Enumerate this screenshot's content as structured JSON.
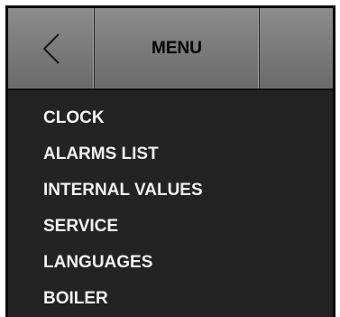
{
  "header": {
    "back_icon": "chevron-left-icon",
    "title": "MENU"
  },
  "menu": {
    "items": [
      {
        "label": "CLOCK"
      },
      {
        "label": "ALARMS LIST"
      },
      {
        "label": "INTERNAL VALUES"
      },
      {
        "label": "SERVICE"
      },
      {
        "label": "LANGUAGES"
      },
      {
        "label": "BOILER"
      }
    ]
  },
  "colors": {
    "panel_background": "#232323",
    "header_background": "#7e7e7e",
    "menu_text": "#f2f2f2",
    "title_text": "#000000"
  }
}
